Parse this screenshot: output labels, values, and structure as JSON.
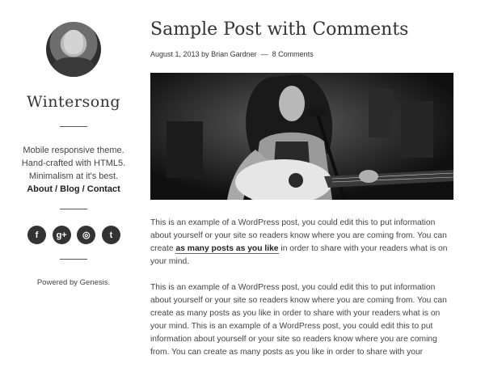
{
  "sidebar": {
    "site_title": "Wintersong",
    "description": [
      "Mobile responsive theme.",
      "Hand-crafted with HTML5.",
      "Minimalism at it's best."
    ],
    "nav_links": [
      "About",
      "Blog",
      "Contact"
    ],
    "nav_separator": " / ",
    "social": [
      {
        "icon": "facebook-icon",
        "glyph": "f"
      },
      {
        "icon": "google-plus-icon",
        "glyph": "g+"
      },
      {
        "icon": "instagram-icon",
        "glyph": "◎"
      },
      {
        "icon": "twitter-icon",
        "glyph": "t"
      }
    ],
    "powered_by": "Powered by Genesis."
  },
  "post": {
    "title": "Sample Post with Comments",
    "meta": {
      "date": "August 1, 2013",
      "by": "by",
      "author": "Brian Gardner",
      "separator": "—",
      "comments": "8 Comments"
    },
    "image_alt": "Black and white photo of a woman playing acoustic guitar and singing into a microphone",
    "paragraph1": {
      "before_link": "This is an example of a WordPress post, you could edit this to put information about yourself or your site so readers know where you are coming from. You can create ",
      "link": "as many posts as you like",
      "after_link": " in order to share with your readers what is on your mind."
    },
    "paragraph2": "This is an example of a WordPress post, you could edit this to put information about yourself or your site so readers know where you are coming from. You can create as many posts as you like in order to share with your readers what is on your mind. This is an example of a WordPress post, you could edit this to put information about yourself or your site so readers know where you are coming from. You can create as many posts as you like in order to share with your"
  }
}
